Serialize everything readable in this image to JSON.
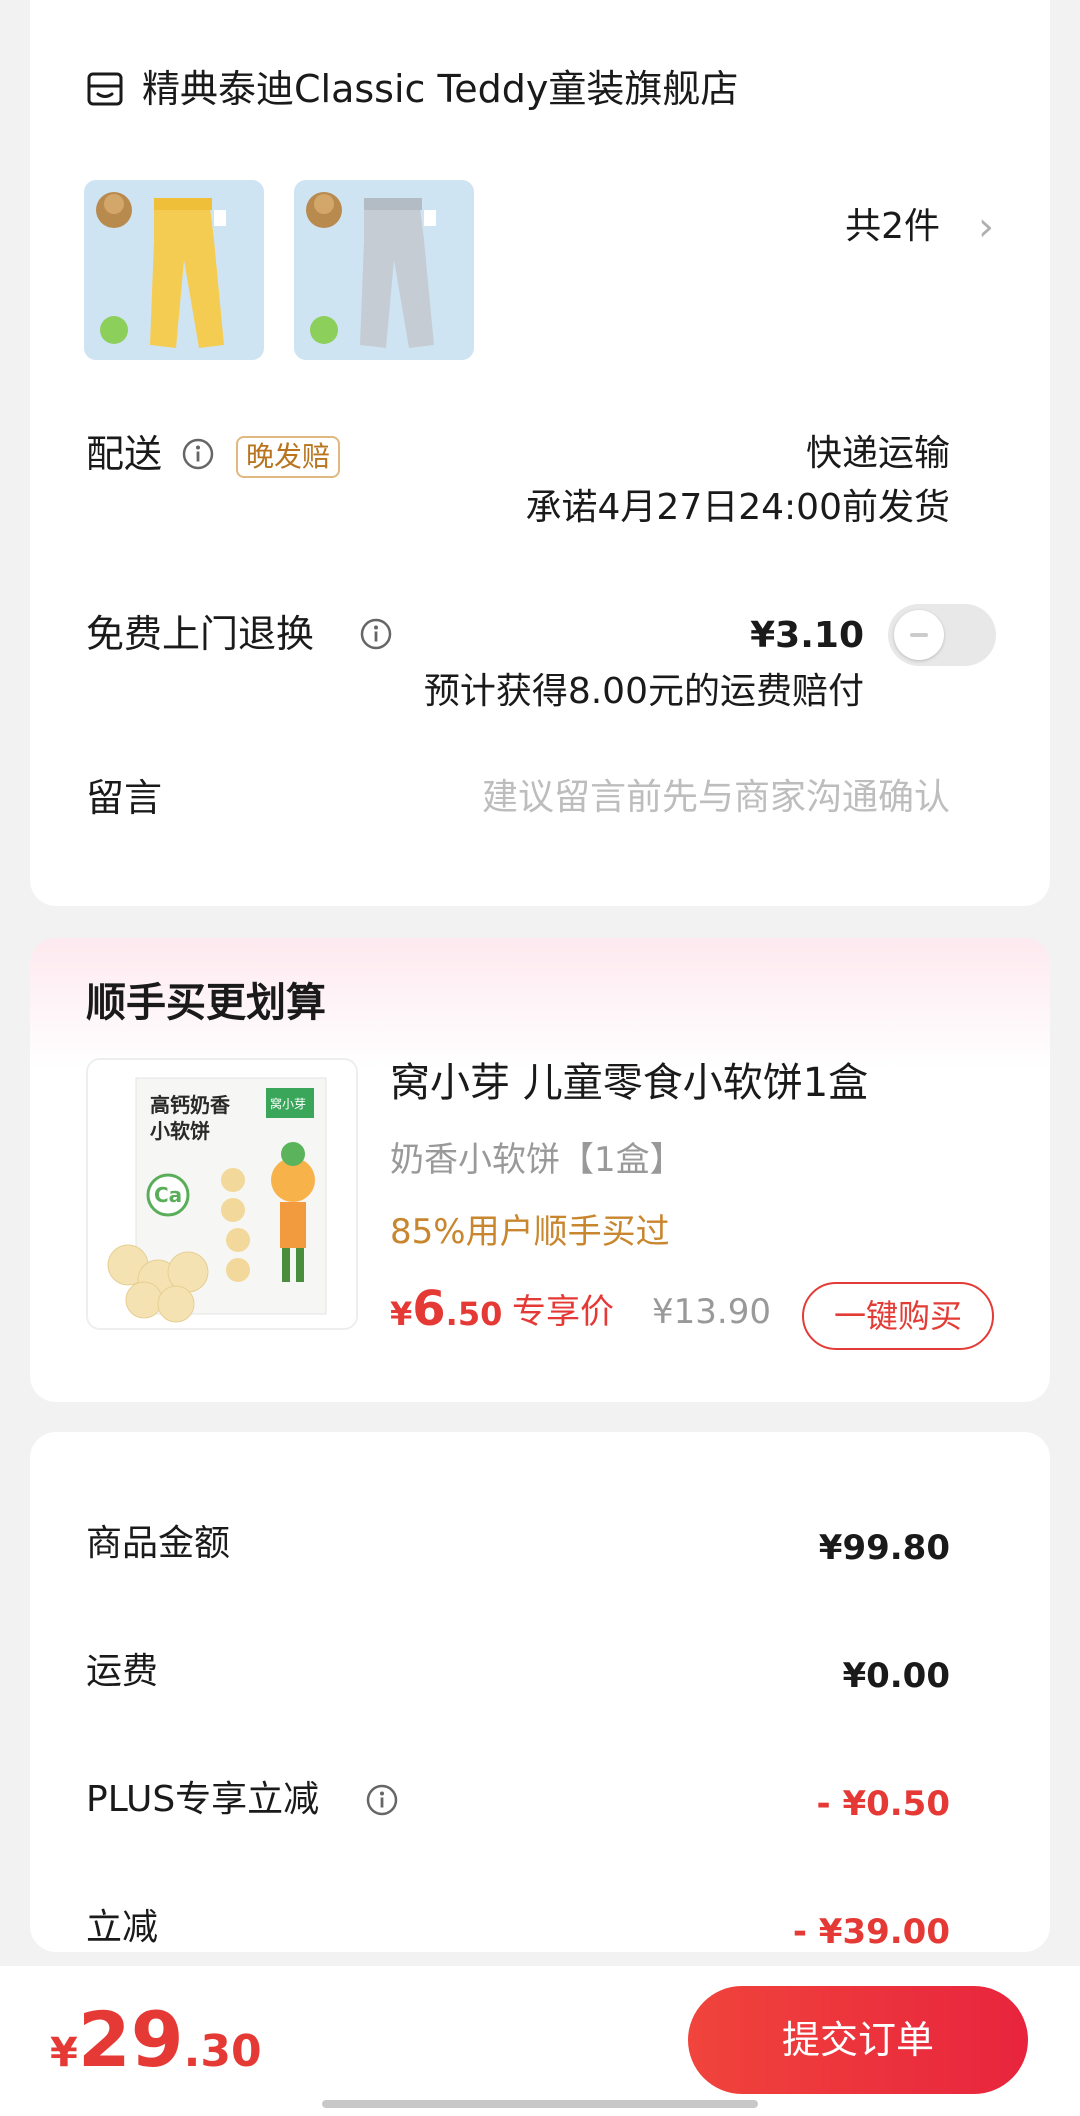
{
  "store": {
    "name": "精典泰迪Classic Teddy童装旗舰店",
    "count_label": "共2件"
  },
  "delivery": {
    "label": "配送",
    "badge": "晚发赔",
    "method": "快递运输",
    "promise": "承诺4月27日24:00前发货"
  },
  "return_service": {
    "label": "免费上门退换",
    "price": "¥3.10",
    "compensation": "预计获得8.00元的运费赔付",
    "toggle_on": false
  },
  "message": {
    "label": "留言",
    "placeholder": "建议留言前先与商家沟通确认"
  },
  "upsell": {
    "title": "顺手买更划算",
    "product_name": "窝小芽 儿童零食小软饼1盒",
    "spec": "奶香小软饼【1盒】",
    "tip": "85%用户顺手买过",
    "price_currency": "¥",
    "price_int": "6",
    "price_dec": ".50",
    "exclusive_label": "专享价",
    "original_price": "¥13.90",
    "buy_label": "一键购买",
    "pack_text_1": "高钙奶香",
    "pack_text_2": "小软饼",
    "pack_brand": "窝小芽",
    "pack_ca": "Ca"
  },
  "summary": {
    "goods_label": "商品金额",
    "goods_value": "¥99.80",
    "shipping_label": "运费",
    "shipping_value": "¥0.00",
    "plus_label": "PLUS专享立减",
    "plus_value": "- ¥0.50",
    "discount_label": "立减",
    "discount_value": "- ¥39.00"
  },
  "bottom": {
    "total_currency": "¥",
    "total_int": "29",
    "total_dec": ".30",
    "submit_label": "提交订单"
  },
  "colors": {
    "accent": "#e53935",
    "orange": "#c8862e",
    "badge_border": "#e0b880"
  }
}
